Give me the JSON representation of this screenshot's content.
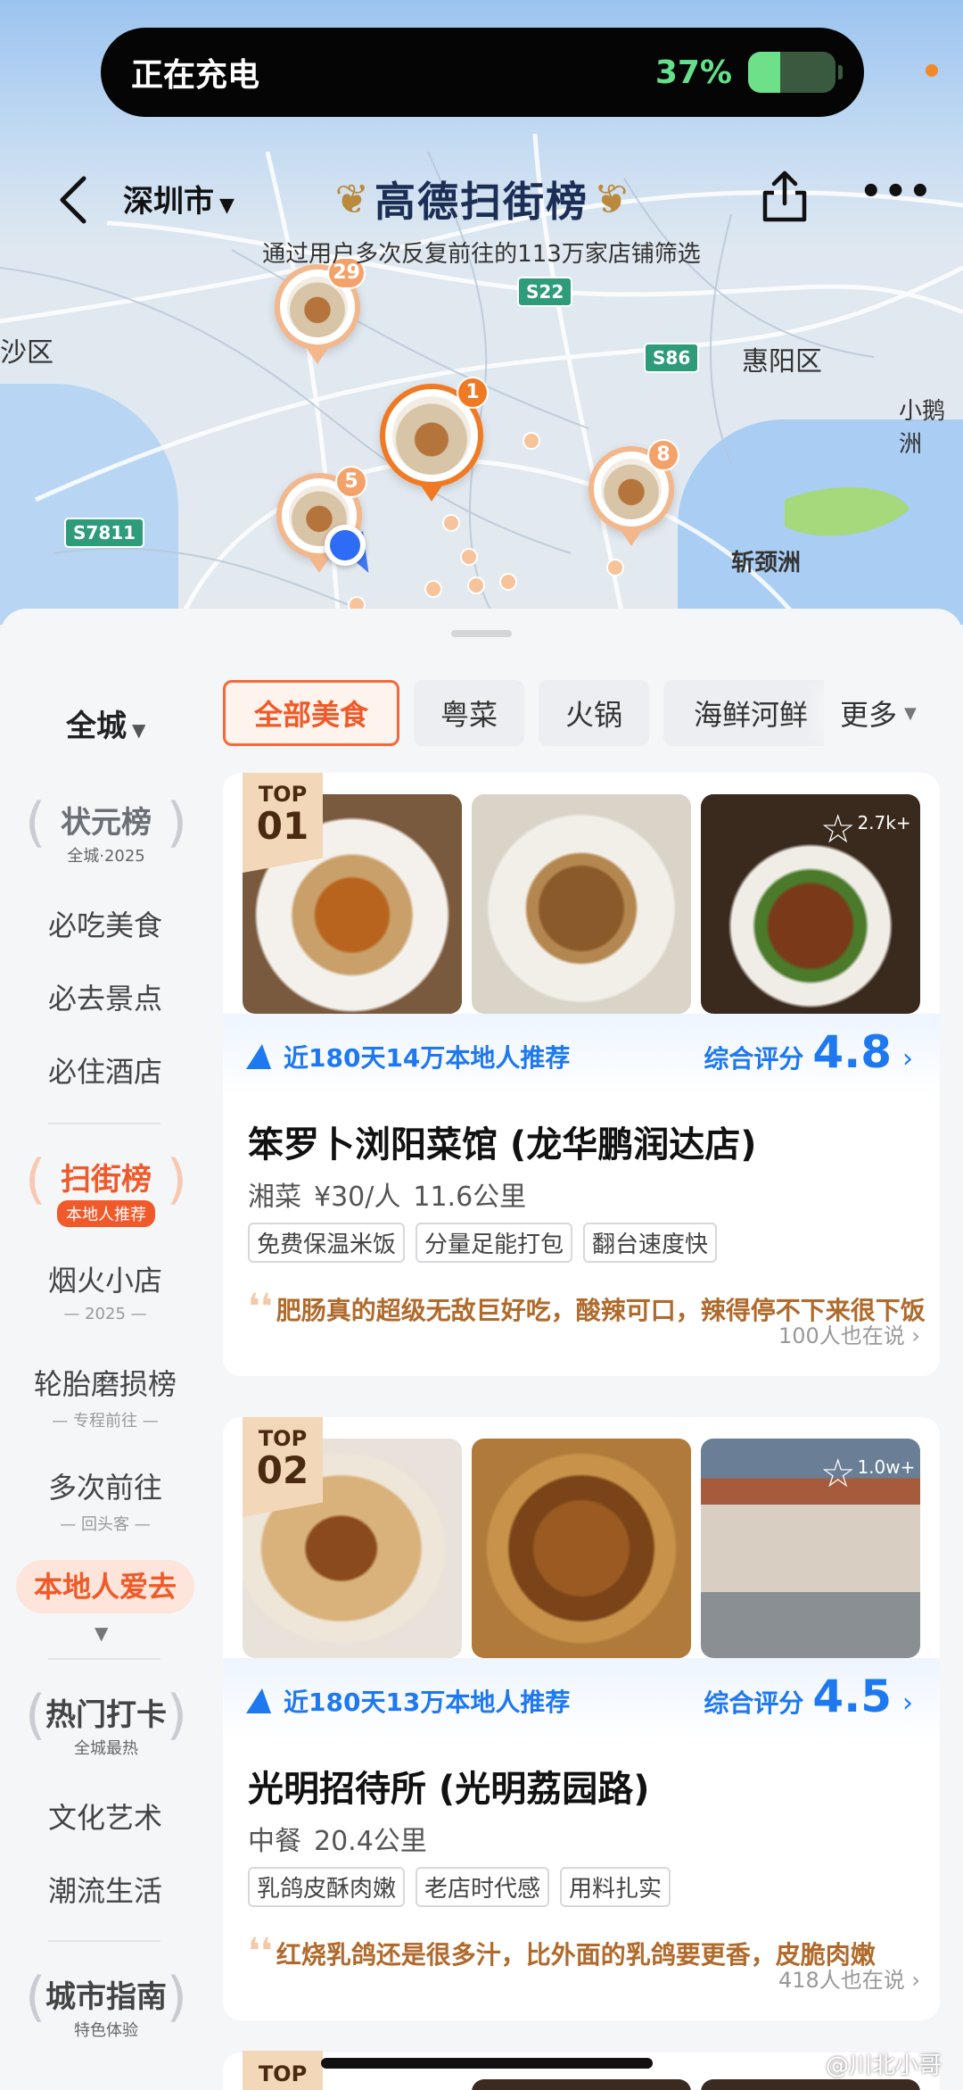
{
  "status_bar": {
    "charging_text": "正在充电",
    "battery_pct": "37%",
    "battery_level": 0.37
  },
  "header": {
    "city": "深圳市",
    "brand_title": "高德扫街榜",
    "subtitle": "通过用户多次反复前往的113万家店铺筛选"
  },
  "map": {
    "places": [
      "沙区",
      "惠阳区",
      "小鹅洲",
      "斩颈洲"
    ],
    "highways": [
      "S22",
      "S86",
      "S7811"
    ],
    "pins": [
      {
        "count": "29"
      },
      {
        "count": "1"
      },
      {
        "count": "5"
      },
      {
        "count": "8"
      }
    ]
  },
  "filters": {
    "city_scope": "全城",
    "chips": [
      "全部美食",
      "粤菜",
      "火锅",
      "海鲜河鲜"
    ],
    "active_chip": "全部美食",
    "more": "更多"
  },
  "sidebar": {
    "badge1": {
      "title": "状元榜",
      "sub": "全城·2025"
    },
    "group1": [
      "必吃美食",
      "必去景点",
      "必住酒店"
    ],
    "badge2": {
      "title": "扫街榜",
      "sub": "本地人推荐"
    },
    "group2": [
      {
        "label": "烟火小店",
        "sub": "2025"
      },
      {
        "label": "轮胎磨损榜",
        "sub": "专程前往"
      },
      {
        "label": "多次前往",
        "sub": "回头客"
      },
      {
        "label": "本地人爱去",
        "sub": ""
      }
    ],
    "badge3": {
      "title": "热门打卡",
      "sub": "全城最热"
    },
    "group3": [
      "文化艺术",
      "潮流生活"
    ],
    "badge4": {
      "title": "城市指南",
      "sub": "特色体验"
    }
  },
  "cards": [
    {
      "rank_top": "TOP",
      "rank_no": "01",
      "favorites": "2.7k+",
      "recommend": "近180天14万本地人推荐",
      "score_label": "综合评分",
      "score": "4.8",
      "name": "笨罗卜浏阳菜馆 (龙华鹏润达店)",
      "cuisine": "湘菜",
      "price": "¥30/人",
      "distance": "11.6公里",
      "tags": [
        "免费保温米饭",
        "分量足能打包",
        "翻台速度快"
      ],
      "quote": "肥肠真的超级无敌巨好吃，酸辣可口，辣得停不下来很下饭",
      "also": "100人也在说"
    },
    {
      "rank_top": "TOP",
      "rank_no": "02",
      "favorites": "1.0w+",
      "recommend": "近180天13万本地人推荐",
      "score_label": "综合评分",
      "score": "4.5",
      "name": "光明招待所 (光明荔园路)",
      "cuisine": "中餐",
      "price": "",
      "distance": "20.4公里",
      "tags": [
        "乳鸽皮酥肉嫩",
        "老店时代感",
        "用料扎实"
      ],
      "quote": "红烧乳鸽还是很多汁，比外面的乳鸽要更香，皮脆肉嫩",
      "also": "418人也在说"
    }
  ],
  "card3": {
    "rank_top": "TOP"
  },
  "watermark": "@川北小哥"
}
